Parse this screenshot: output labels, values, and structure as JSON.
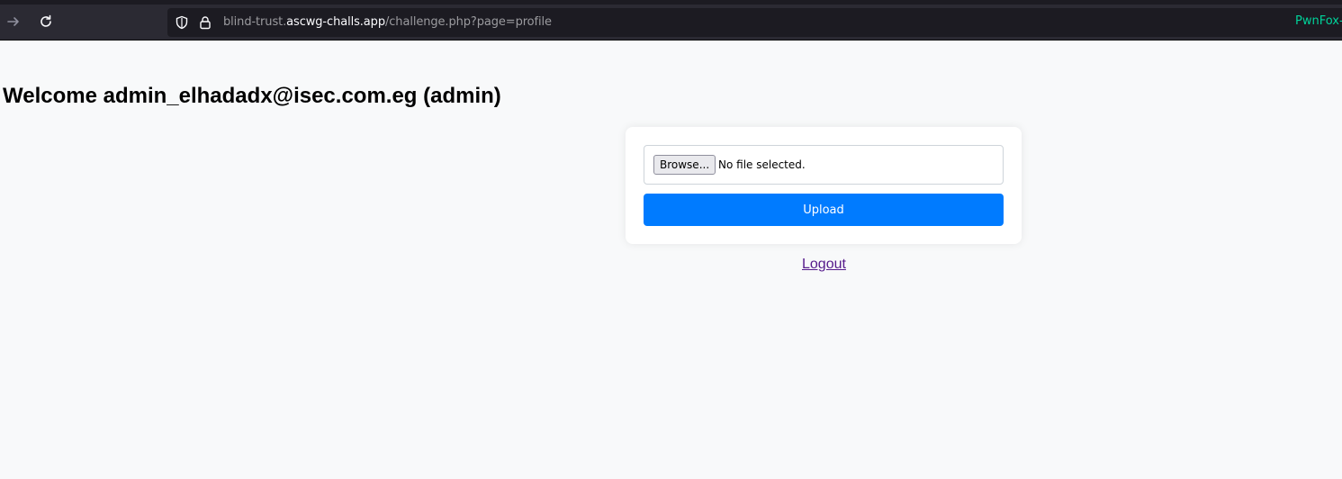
{
  "browser": {
    "url_prefix": "blind-trust.",
    "url_host": "ascwg-challs.app",
    "url_path": "/challenge.php?page=profile",
    "extension_label": "PwnFox-"
  },
  "page": {
    "welcome": "Welcome admin_elhadadx@isec.com.eg (admin)",
    "file_input": {
      "button_label": "Browse...",
      "status": "No file selected."
    },
    "upload_label": "Upload",
    "logout_label": "Logout"
  },
  "colors": {
    "primary": "#007bff",
    "link_visited": "#551a8b",
    "toolbar_bg": "#2b2a33",
    "page_bg": "#f8f9fa"
  }
}
